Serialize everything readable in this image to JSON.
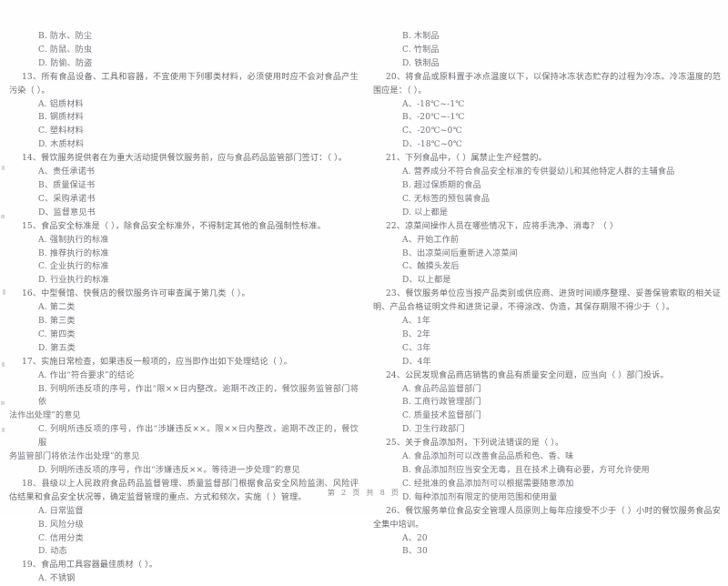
{
  "document": {
    "page_footer": "第 2 页 共 8 页",
    "page_number": "2",
    "total_pages": "8",
    "text_color": "#6e6e74",
    "background_color": "#ffffff"
  },
  "left_column": {
    "items": [
      {
        "type": "option",
        "text": "B. 防水、防尘"
      },
      {
        "type": "option",
        "text": "C. 防鼠、防虫"
      },
      {
        "type": "option",
        "text": "D. 防偷、防盗"
      },
      {
        "type": "stem",
        "text": "13、所有食品设备、工具和容器，不宜使用下列哪类材料，必须使用时应不会对食品产生污染（    ）。"
      },
      {
        "type": "option",
        "text": "A. 铝质材料"
      },
      {
        "type": "option",
        "text": "B. 钢质材料"
      },
      {
        "type": "option",
        "text": "C. 塑料材料"
      },
      {
        "type": "option",
        "text": "D. 木质材料"
      },
      {
        "type": "stem",
        "text": "14、餐饮服务提供者在为重大活动提供餐饮服务前，应与食品药品监管部门签订：（    ）。"
      },
      {
        "type": "option",
        "text": "A、责任承诺书"
      },
      {
        "type": "option",
        "text": "B、质量保证书"
      },
      {
        "type": "option",
        "text": "C、采购承诺书"
      },
      {
        "type": "option",
        "text": "D、监督意见书"
      },
      {
        "type": "stem",
        "text": "15、食品安全标准是（    ），除食品安全标准外，不得制定其他的食品强制性标准。"
      },
      {
        "type": "option",
        "text": "A. 强制执行的标准"
      },
      {
        "type": "option",
        "text": "B. 推荐执行的标准"
      },
      {
        "type": "option",
        "text": "C. 企业执行的标准"
      },
      {
        "type": "option",
        "text": "D. 行业执行的标准"
      },
      {
        "type": "stem",
        "text": "16、中型餐馆、快餐店的餐饮服务许可审查属于第几类（    ）。"
      },
      {
        "type": "option",
        "text": "A. 第二类"
      },
      {
        "type": "option",
        "text": "B. 第三类"
      },
      {
        "type": "option",
        "text": "C. 第四类"
      },
      {
        "type": "option",
        "text": "D. 第五类"
      },
      {
        "type": "stem",
        "text": "17、实施日常检查，如果违反一般项的，应当即作出如下处理结论（    ）。"
      },
      {
        "type": "option",
        "text": "A. 作出“符合要求”的结论"
      },
      {
        "type": "option_wrap",
        "text": "B. 列明所违反项的序号，作出“限××日内整改。逾期不改正的，餐饮服务监管部门将依",
        "cont": "法作出处理”的意见"
      },
      {
        "type": "option_wrap",
        "text": "C. 列明所违反项的序号，作出“涉嫌违反××。限××日内整改，逾期不改正的，餐饮服",
        "cont": "务监管部门将依法作出处理”的意见"
      },
      {
        "type": "option",
        "text": "D. 列明所违反项的序号，作出“涉嫌违反××。等待进一步处理”的意见"
      },
      {
        "type": "stem",
        "text": "18、县级以上人民政府食品药品监督管理、质量监督部门根据食品安全风险监测、风险评估结果和食品安全状况等，确定监督管理的重点、方式和频次，实施（    ）管理。"
      },
      {
        "type": "option",
        "text": "A. 日常监督"
      },
      {
        "type": "option",
        "text": "B. 风险分级"
      },
      {
        "type": "option",
        "text": "C. 信用分类"
      },
      {
        "type": "option",
        "text": "D. 动态"
      },
      {
        "type": "stem",
        "text": "19、食品用工具容器最佳质材（    ）。"
      },
      {
        "type": "option",
        "text": "A. 不锈钢"
      }
    ]
  },
  "right_column": {
    "items": [
      {
        "type": "option",
        "text": "B. 木制品"
      },
      {
        "type": "option",
        "text": "C. 竹制品"
      },
      {
        "type": "option",
        "text": "D. 铁制品"
      },
      {
        "type": "stem",
        "text": "20、将食品或原料置于冰点温度以下，以保持冰冻状态贮存的过程为冷冻。冷冻温度的范围应是：（    ）。"
      },
      {
        "type": "option",
        "text": "A、-18℃~-1℃"
      },
      {
        "type": "option",
        "text": "B、-20℃~-1℃"
      },
      {
        "type": "option",
        "text": "C、-20℃~0℃"
      },
      {
        "type": "option",
        "text": "D、-18℃~0℃"
      },
      {
        "type": "stem",
        "text": "21、下列食品中，（    ）属禁止生产经营的。"
      },
      {
        "type": "option",
        "text": "A. 营养成分不符合食品安全标准的专供婴幼儿和其他特定人群的主辅食品"
      },
      {
        "type": "option",
        "text": "B. 超过保质期的食品"
      },
      {
        "type": "option",
        "text": "C. 无标签的预包装食品"
      },
      {
        "type": "option",
        "text": "D. 以上都是"
      },
      {
        "type": "stem",
        "text": "22、凉菜间操作人员在哪些情况下，应将手洗净、消毒？（    ）"
      },
      {
        "type": "option",
        "text": "A、开始工作前"
      },
      {
        "type": "option",
        "text": "B、出凉菜间后重新进入凉菜间"
      },
      {
        "type": "option",
        "text": "C、触摸头发后"
      },
      {
        "type": "option",
        "text": "D、以上都是"
      },
      {
        "type": "stem",
        "text": "23、餐饮服务单位应当按产品类别或供应商、进货时间顺序整理、妥善保管索取的相关证明、产品合格证明文件和进货记录，不得涂改、伪造，其保存期限不得少于（    ）。"
      },
      {
        "type": "option",
        "text": "A、1年"
      },
      {
        "type": "option",
        "text": "B、2年"
      },
      {
        "type": "option",
        "text": "C、3年"
      },
      {
        "type": "option",
        "text": "D、4年"
      },
      {
        "type": "stem",
        "text": "24、公民发现食品商店销售的食品有质量安全问题，应当向（    ）部门投诉。"
      },
      {
        "type": "option",
        "text": "A. 食品药品监督部门"
      },
      {
        "type": "option",
        "text": "B. 工商行政管理部门"
      },
      {
        "type": "option",
        "text": "C. 质量技术监督部门"
      },
      {
        "type": "option",
        "text": "D. 卫生行政部门"
      },
      {
        "type": "stem",
        "text": "25、关于食品添加剂，下列说法错误的是（    ）。"
      },
      {
        "type": "option",
        "text": "A. 食品添加剂可以改善食品品质和色、香、味"
      },
      {
        "type": "option",
        "text": "B. 食品添加剂应当安全无毒，且在技术上确有必要，方可允许使用"
      },
      {
        "type": "option",
        "text": "C. 经批准的食品添加剂可以根据需要随意添加"
      },
      {
        "type": "option",
        "text": "D. 每种添加剂有限定的使用范围和使用量"
      },
      {
        "type": "stem",
        "text": "26、餐饮服务单位食品安全管理人员原则上每年应接受不少于（    ）小时的餐饮服务食品安全集中培训。"
      },
      {
        "type": "option",
        "text": "A、20"
      },
      {
        "type": "option",
        "text": "B、30"
      }
    ]
  }
}
